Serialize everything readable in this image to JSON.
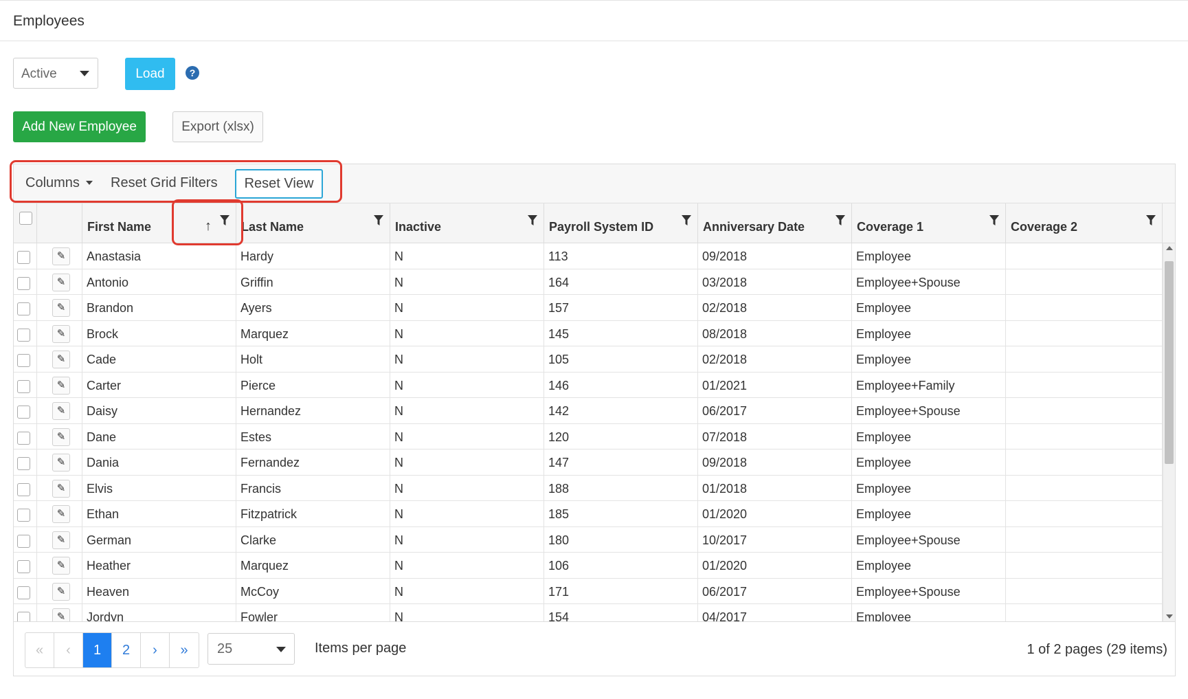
{
  "page": {
    "title": "Employees"
  },
  "filters": {
    "status_value": "Active",
    "load_label": "Load",
    "help_glyph": "?"
  },
  "actions": {
    "add_label": "Add New Employee",
    "export_label": "Export (xlsx)"
  },
  "toolbar": {
    "columns_label": "Columns",
    "reset_filters_label": "Reset Grid Filters",
    "reset_view_label": "Reset View"
  },
  "grid": {
    "columns": [
      "First Name",
      "Last Name",
      "Inactive",
      "Payroll System ID",
      "Anniversary Date",
      "Coverage 1",
      "Coverage 2"
    ],
    "sort": {
      "column": "First Name",
      "direction": "ascending"
    },
    "rows": [
      [
        "Anastasia",
        "Hardy",
        "N",
        "113",
        "09/2018",
        "Employee",
        ""
      ],
      [
        "Antonio",
        "Griffin",
        "N",
        "164",
        "03/2018",
        "Employee+Spouse",
        ""
      ],
      [
        "Brandon",
        "Ayers",
        "N",
        "157",
        "02/2018",
        "Employee",
        ""
      ],
      [
        "Brock",
        "Marquez",
        "N",
        "145",
        "08/2018",
        "Employee",
        ""
      ],
      [
        "Cade",
        "Holt",
        "N",
        "105",
        "02/2018",
        "Employee",
        ""
      ],
      [
        "Carter",
        "Pierce",
        "N",
        "146",
        "01/2021",
        "Employee+Family",
        ""
      ],
      [
        "Daisy",
        "Hernandez",
        "N",
        "142",
        "06/2017",
        "Employee+Spouse",
        ""
      ],
      [
        "Dane",
        "Estes",
        "N",
        "120",
        "07/2018",
        "Employee",
        ""
      ],
      [
        "Dania",
        "Fernandez",
        "N",
        "147",
        "09/2018",
        "Employee",
        ""
      ],
      [
        "Elvis",
        "Francis",
        "N",
        "188",
        "01/2018",
        "Employee",
        ""
      ],
      [
        "Ethan",
        "Fitzpatrick",
        "N",
        "185",
        "01/2020",
        "Employee",
        ""
      ],
      [
        "German",
        "Clarke",
        "N",
        "180",
        "10/2017",
        "Employee+Spouse",
        ""
      ],
      [
        "Heather",
        "Marquez",
        "N",
        "106",
        "01/2020",
        "Employee",
        ""
      ],
      [
        "Heaven",
        "McCoy",
        "N",
        "171",
        "06/2017",
        "Employee+Spouse",
        ""
      ],
      [
        "Jordyn",
        "Fowler",
        "N",
        "154",
        "04/2017",
        "Employee",
        ""
      ]
    ]
  },
  "pager": {
    "first": "«",
    "prev": "‹",
    "pages": [
      "1",
      "2"
    ],
    "current_page": "1",
    "next": "›",
    "last": "»",
    "page_size": "25",
    "items_per_page_label": "Items per page",
    "info": "1 of 2 pages (29 items)"
  },
  "colors": {
    "load": "#30bcf0",
    "add": "#28a745",
    "active_page": "#1e7ff0",
    "highlight": "#e03a2f"
  }
}
